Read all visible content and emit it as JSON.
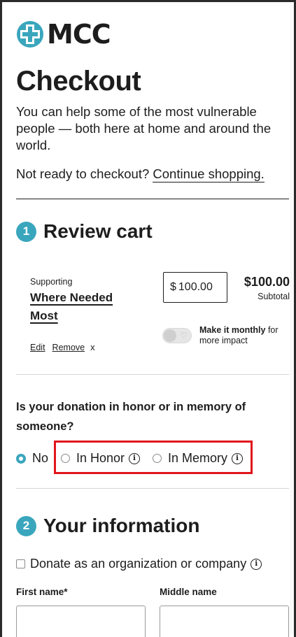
{
  "brand": {
    "name": "MCC",
    "accent": "#3aa6bd",
    "highlight_color": "#e0161c"
  },
  "header": {
    "title": "Checkout",
    "intro": "You can help some of the most vulnerable people — both here at home and around the world.",
    "not_ready_text": "Not ready to checkout?",
    "continue_link": "Continue shopping."
  },
  "review_cart": {
    "step_number": "1",
    "title": "Review cart",
    "item": {
      "supporting_label": "Supporting",
      "fund_name": "Where Needed Most",
      "currency_symbol": "$",
      "amount_value": "100.00",
      "total": "$100.00",
      "subtotal_label": "Subtotal",
      "edit_link": "Edit",
      "remove_link": "Remove",
      "remove_x": "x",
      "monthly_toggle_on": false,
      "monthly_bold": "Make it monthly",
      "monthly_rest": " for more impact"
    }
  },
  "honor": {
    "question": "Is your donation in honor or in memory of someone?",
    "options": [
      {
        "label": "No",
        "selected": true
      },
      {
        "label": "In Honor",
        "selected": false
      },
      {
        "label": "In Memory",
        "selected": false
      }
    ]
  },
  "your_info": {
    "step_number": "2",
    "title": "Your information",
    "organization_checkbox": "Donate as an organization or company",
    "first_name_label": "First name*",
    "middle_name_label": "Middle name"
  }
}
